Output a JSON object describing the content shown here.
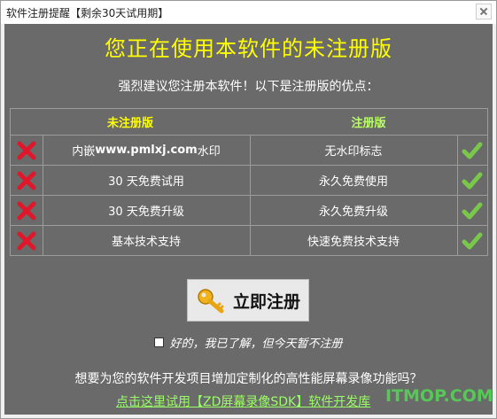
{
  "window": {
    "title": "软件注册提醒【剩余30天试用期】"
  },
  "headline": "您正在使用本软件的未注册版",
  "subhead": "强烈建议您注册本软件！以下是注册版的优点：",
  "table": {
    "headers": {
      "unregistered": "未注册版",
      "registered": "注册版"
    },
    "rows": [
      {
        "unregistered_prefix": "内嵌 ",
        "unregistered_url": "www.pmlxj.com",
        "unregistered_suffix": " 水印",
        "registered": "无水印标志"
      },
      {
        "unregistered": "30 天免费试用",
        "registered": "永久免费使用"
      },
      {
        "unregistered": "30 天免费升级",
        "registered": "永久免费升级"
      },
      {
        "unregistered": "基本技术支持",
        "registered": "快速免费技术支持"
      }
    ]
  },
  "register_button": {
    "label": "立即注册",
    "icon": "key-icon"
  },
  "dismiss_checkbox": {
    "label": "好的，我已了解，但今天暂不注册",
    "checked": false
  },
  "question": "想要为您的软件开发项目增加定制化的高性能屏幕录像功能吗？",
  "sdk_link": "点击这里试用【ZD屏幕录像SDK】软件开发库",
  "watermark": "ITMOP.COM",
  "colors": {
    "headline": "#ffff00",
    "registered_header": "#b8ff66",
    "cross": "#e0162b",
    "check": "#79c84a",
    "link": "#99ff66"
  }
}
